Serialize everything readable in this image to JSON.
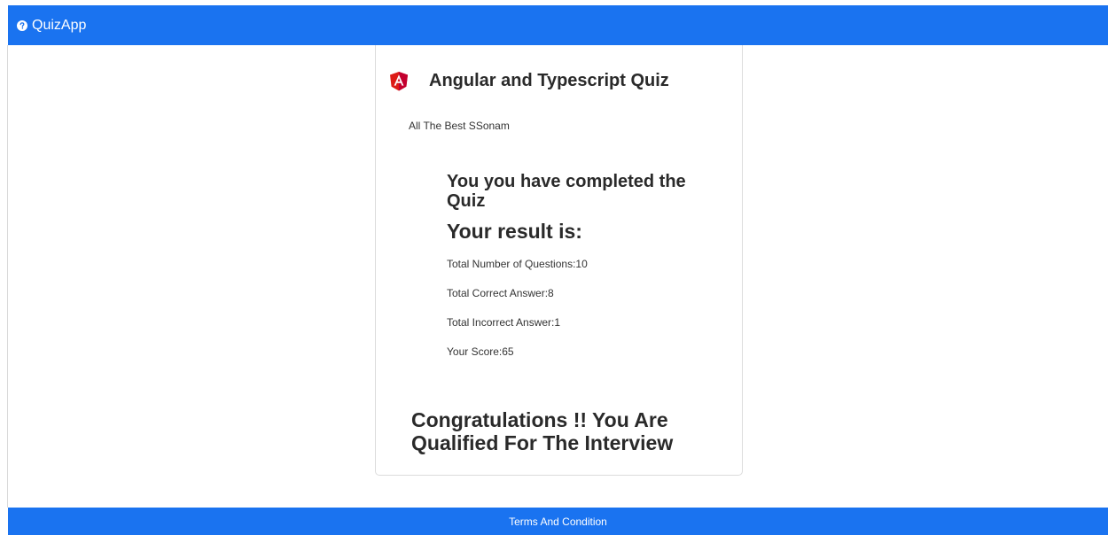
{
  "navbar": {
    "brand_icon": "question-circle-icon",
    "brand_label": "QuizApp",
    "color": "#1a73f0"
  },
  "quiz": {
    "icon": "angular-logo-icon",
    "title": "Angular and Typescript Quiz",
    "greeting": "All The Best SSonam"
  },
  "result": {
    "completed_text": "You you have completed the Quiz",
    "heading": "Your result is:",
    "stats": [
      "Total Number of Questions:10",
      "Total Correct Answer:8",
      "Total Incorrect Answer:1",
      "Your Score:65"
    ],
    "congrats": "Congratulations !! You Are Qualified For The Interview"
  },
  "footer": {
    "link_label": "Terms And Condition"
  }
}
